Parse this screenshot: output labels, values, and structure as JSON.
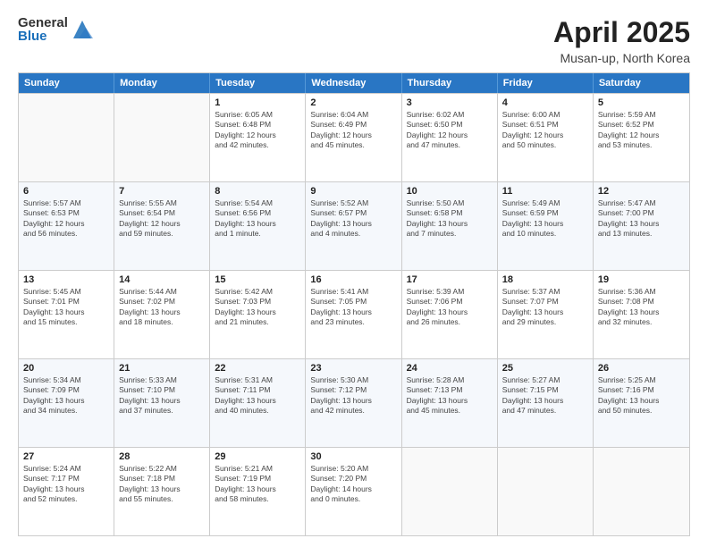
{
  "logo": {
    "general": "General",
    "blue": "Blue"
  },
  "title": "April 2025",
  "subtitle": "Musan-up, North Korea",
  "weekdays": [
    "Sunday",
    "Monday",
    "Tuesday",
    "Wednesday",
    "Thursday",
    "Friday",
    "Saturday"
  ],
  "rows": [
    [
      {
        "day": "",
        "info": ""
      },
      {
        "day": "",
        "info": ""
      },
      {
        "day": "1",
        "info": "Sunrise: 6:05 AM\nSunset: 6:48 PM\nDaylight: 12 hours\nand 42 minutes."
      },
      {
        "day": "2",
        "info": "Sunrise: 6:04 AM\nSunset: 6:49 PM\nDaylight: 12 hours\nand 45 minutes."
      },
      {
        "day": "3",
        "info": "Sunrise: 6:02 AM\nSunset: 6:50 PM\nDaylight: 12 hours\nand 47 minutes."
      },
      {
        "day": "4",
        "info": "Sunrise: 6:00 AM\nSunset: 6:51 PM\nDaylight: 12 hours\nand 50 minutes."
      },
      {
        "day": "5",
        "info": "Sunrise: 5:59 AM\nSunset: 6:52 PM\nDaylight: 12 hours\nand 53 minutes."
      }
    ],
    [
      {
        "day": "6",
        "info": "Sunrise: 5:57 AM\nSunset: 6:53 PM\nDaylight: 12 hours\nand 56 minutes."
      },
      {
        "day": "7",
        "info": "Sunrise: 5:55 AM\nSunset: 6:54 PM\nDaylight: 12 hours\nand 59 minutes."
      },
      {
        "day": "8",
        "info": "Sunrise: 5:54 AM\nSunset: 6:56 PM\nDaylight: 13 hours\nand 1 minute."
      },
      {
        "day": "9",
        "info": "Sunrise: 5:52 AM\nSunset: 6:57 PM\nDaylight: 13 hours\nand 4 minutes."
      },
      {
        "day": "10",
        "info": "Sunrise: 5:50 AM\nSunset: 6:58 PM\nDaylight: 13 hours\nand 7 minutes."
      },
      {
        "day": "11",
        "info": "Sunrise: 5:49 AM\nSunset: 6:59 PM\nDaylight: 13 hours\nand 10 minutes."
      },
      {
        "day": "12",
        "info": "Sunrise: 5:47 AM\nSunset: 7:00 PM\nDaylight: 13 hours\nand 13 minutes."
      }
    ],
    [
      {
        "day": "13",
        "info": "Sunrise: 5:45 AM\nSunset: 7:01 PM\nDaylight: 13 hours\nand 15 minutes."
      },
      {
        "day": "14",
        "info": "Sunrise: 5:44 AM\nSunset: 7:02 PM\nDaylight: 13 hours\nand 18 minutes."
      },
      {
        "day": "15",
        "info": "Sunrise: 5:42 AM\nSunset: 7:03 PM\nDaylight: 13 hours\nand 21 minutes."
      },
      {
        "day": "16",
        "info": "Sunrise: 5:41 AM\nSunset: 7:05 PM\nDaylight: 13 hours\nand 23 minutes."
      },
      {
        "day": "17",
        "info": "Sunrise: 5:39 AM\nSunset: 7:06 PM\nDaylight: 13 hours\nand 26 minutes."
      },
      {
        "day": "18",
        "info": "Sunrise: 5:37 AM\nSunset: 7:07 PM\nDaylight: 13 hours\nand 29 minutes."
      },
      {
        "day": "19",
        "info": "Sunrise: 5:36 AM\nSunset: 7:08 PM\nDaylight: 13 hours\nand 32 minutes."
      }
    ],
    [
      {
        "day": "20",
        "info": "Sunrise: 5:34 AM\nSunset: 7:09 PM\nDaylight: 13 hours\nand 34 minutes."
      },
      {
        "day": "21",
        "info": "Sunrise: 5:33 AM\nSunset: 7:10 PM\nDaylight: 13 hours\nand 37 minutes."
      },
      {
        "day": "22",
        "info": "Sunrise: 5:31 AM\nSunset: 7:11 PM\nDaylight: 13 hours\nand 40 minutes."
      },
      {
        "day": "23",
        "info": "Sunrise: 5:30 AM\nSunset: 7:12 PM\nDaylight: 13 hours\nand 42 minutes."
      },
      {
        "day": "24",
        "info": "Sunrise: 5:28 AM\nSunset: 7:13 PM\nDaylight: 13 hours\nand 45 minutes."
      },
      {
        "day": "25",
        "info": "Sunrise: 5:27 AM\nSunset: 7:15 PM\nDaylight: 13 hours\nand 47 minutes."
      },
      {
        "day": "26",
        "info": "Sunrise: 5:25 AM\nSunset: 7:16 PM\nDaylight: 13 hours\nand 50 minutes."
      }
    ],
    [
      {
        "day": "27",
        "info": "Sunrise: 5:24 AM\nSunset: 7:17 PM\nDaylight: 13 hours\nand 52 minutes."
      },
      {
        "day": "28",
        "info": "Sunrise: 5:22 AM\nSunset: 7:18 PM\nDaylight: 13 hours\nand 55 minutes."
      },
      {
        "day": "29",
        "info": "Sunrise: 5:21 AM\nSunset: 7:19 PM\nDaylight: 13 hours\nand 58 minutes."
      },
      {
        "day": "30",
        "info": "Sunrise: 5:20 AM\nSunset: 7:20 PM\nDaylight: 14 hours\nand 0 minutes."
      },
      {
        "day": "",
        "info": ""
      },
      {
        "day": "",
        "info": ""
      },
      {
        "day": "",
        "info": ""
      }
    ]
  ]
}
